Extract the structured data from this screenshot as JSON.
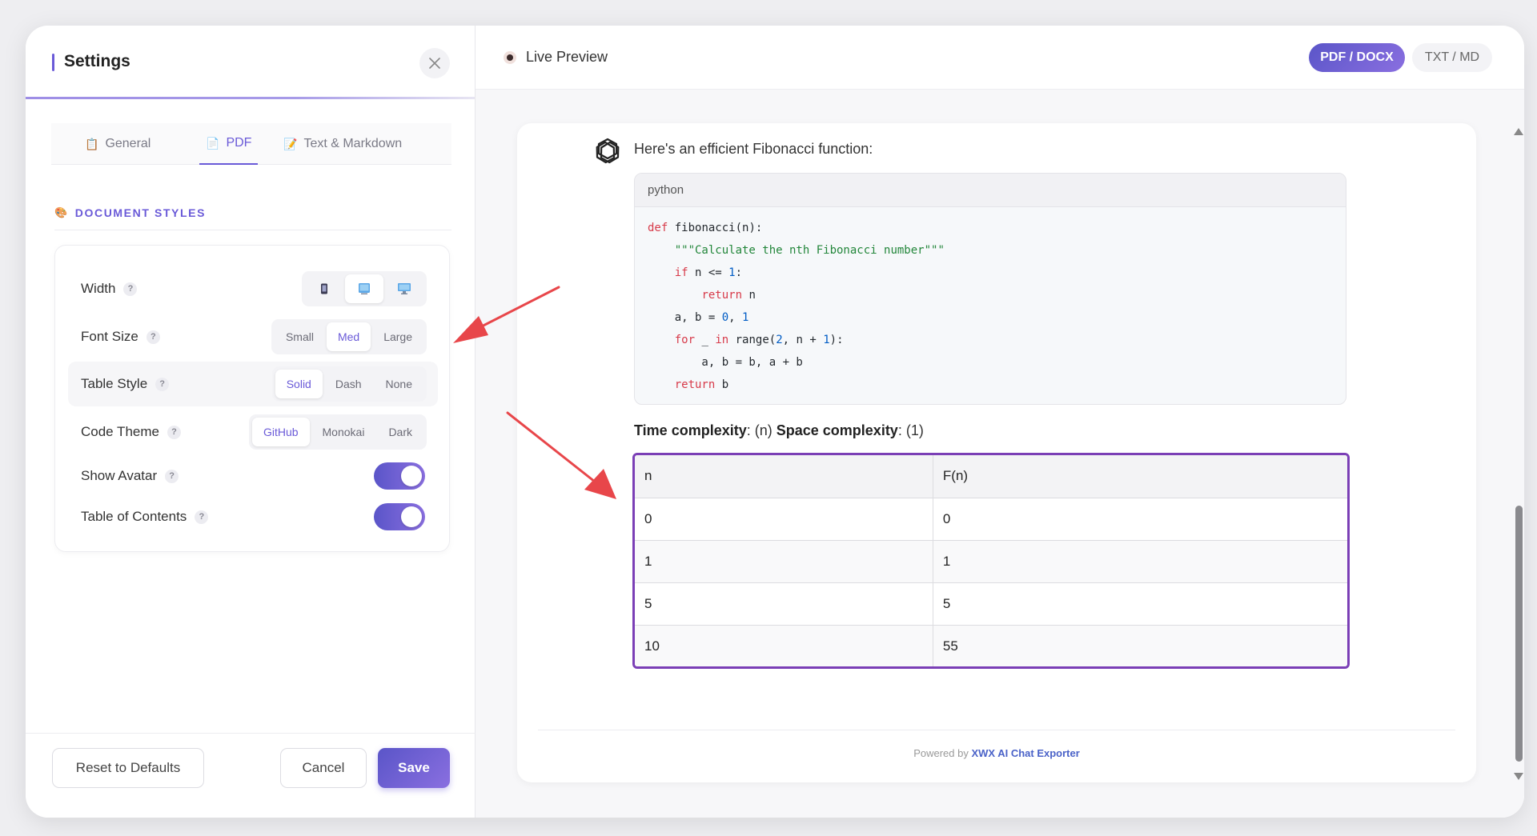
{
  "settings": {
    "title": "Settings",
    "tabs": [
      {
        "label": "General",
        "icon": "clipboard-icon"
      },
      {
        "label": "PDF",
        "icon": "document-icon",
        "active": true
      },
      {
        "label": "Text & Markdown",
        "icon": "memo-icon"
      }
    ],
    "section_title": "DOCUMENT STYLES",
    "rows": {
      "width": {
        "label": "Width",
        "options": [
          "phone-icon",
          "tablet-icon",
          "desktop-icon"
        ],
        "selected": "tablet-icon"
      },
      "font_size": {
        "label": "Font Size",
        "options": [
          "Small",
          "Med",
          "Large"
        ],
        "selected": "Med"
      },
      "table_style": {
        "label": "Table Style",
        "options": [
          "Solid",
          "Dash",
          "None"
        ],
        "selected": "Solid"
      },
      "code_theme": {
        "label": "Code Theme",
        "options": [
          "GitHub",
          "Monokai",
          "Dark"
        ],
        "selected": "GitHub"
      },
      "show_avatar": {
        "label": "Show Avatar",
        "on": true
      },
      "toc": {
        "label": "Table of Contents",
        "on": true
      }
    },
    "help_glyph": "?",
    "footer": {
      "reset": "Reset to Defaults",
      "cancel": "Cancel",
      "save": "Save"
    }
  },
  "preview": {
    "title": "Live Preview",
    "formats": {
      "pdf": "PDF / DOCX",
      "txt": "TXT / MD"
    },
    "intro": "Here's an efficient Fibonacci function:",
    "code_lang": "python",
    "complexity": {
      "time_label": "Time complexity",
      "time_value": ": (n) ",
      "space_label": "Space complexity",
      "space_value": ": (1)"
    },
    "table": {
      "headers": [
        "n",
        "F(n)"
      ],
      "rows": [
        [
          "0",
          "0"
        ],
        [
          "1",
          "1"
        ],
        [
          "5",
          "5"
        ],
        [
          "10",
          "55"
        ]
      ]
    },
    "powered_prefix": "Powered by ",
    "powered_brand": "XWX AI Chat Exporter"
  },
  "colors": {
    "accent": "#6a5ad8",
    "table_border": "#7b3fb6",
    "annotation_arrow": "#e8464a",
    "brand_link": "#4a62c8"
  }
}
